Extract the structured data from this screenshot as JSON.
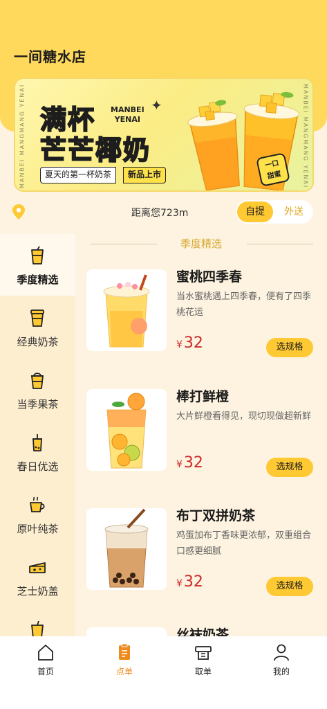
{
  "header": {
    "title": "一间糖水店"
  },
  "banner": {
    "side_left": "MANBEI MANGMANG YENAI",
    "side_right": "MANBEI MANGMANG YENAI",
    "headline_line1": "满杯",
    "headline_line2": "芒芒椰奶",
    "brand_line1": "MANBEI",
    "brand_line2": "YENAI",
    "tagline": "夏天的第一杯奶茶",
    "new_badge": "新品上市",
    "sticker_line1": "一口",
    "sticker_line2": "甜蜜"
  },
  "location": {
    "distance_text": "距离您723m",
    "modes": {
      "pickup": "自提",
      "delivery": "外送"
    },
    "selected_mode": "pickup"
  },
  "sidebar": {
    "items": [
      {
        "label": "季度精选",
        "icon": "cup-icon",
        "active": true
      },
      {
        "label": "经典奶茶",
        "icon": "coffee-cup-icon",
        "active": false
      },
      {
        "label": "当季果茶",
        "icon": "cup-lid-icon",
        "active": false
      },
      {
        "label": "春日优选",
        "icon": "bubble-tea-icon",
        "active": false
      },
      {
        "label": "原叶纯茶",
        "icon": "tea-mug-icon",
        "active": false
      },
      {
        "label": "芝士奶盖",
        "icon": "cheese-icon",
        "active": false
      }
    ]
  },
  "main": {
    "section_title": "季度精选",
    "products": [
      {
        "name": "蜜桃四季春",
        "desc": "当水蜜桃遇上四季春，便有了四季桃花运",
        "currency": "¥",
        "price": "32",
        "button": "选规格"
      },
      {
        "name": "棒打鲜橙",
        "desc": "大片鲜橙看得见，现切现做超新鲜",
        "currency": "¥",
        "price": "32",
        "button": "选规格"
      },
      {
        "name": "布丁双拼奶茶",
        "desc": "鸡蛋加布丁香味更浓郁，双重组合口感更细腻",
        "currency": "¥",
        "price": "32",
        "button": "选规格"
      },
      {
        "name": "丝袜奶茶",
        "desc": "",
        "currency": "¥",
        "price": "",
        "button": ""
      }
    ]
  },
  "tabbar": {
    "items": [
      {
        "label": "首页",
        "icon": "home-icon",
        "active": false
      },
      {
        "label": "点单",
        "icon": "order-icon",
        "active": true
      },
      {
        "label": "取单",
        "icon": "pickup-icon",
        "active": false
      },
      {
        "label": "我的",
        "icon": "user-icon",
        "active": false
      }
    ]
  },
  "colors": {
    "accent": "#ffc933",
    "header": "#ffd95c",
    "price": "#cc2a2a",
    "active_tab": "#f08a1c"
  }
}
